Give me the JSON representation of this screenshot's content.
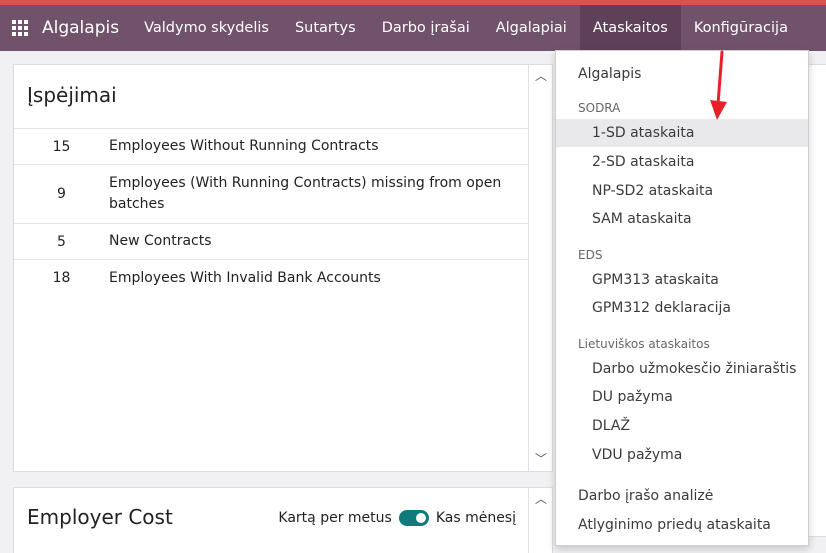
{
  "navbar": {
    "brand": "Algalapis",
    "items": [
      "Valdymo skydelis",
      "Sutartys",
      "Darbo įrašai",
      "Algalapiai",
      "Ataskaitos",
      "Konfigūracija"
    ]
  },
  "warnings": {
    "title": "Įspėjimai",
    "rows": [
      {
        "count": "15",
        "label": "Employees Without Running Contracts"
      },
      {
        "count": "9",
        "label": "Employees (With Running Contracts) missing from open batches"
      },
      {
        "count": "5",
        "label": "New Contracts"
      },
      {
        "count": "18",
        "label": "Employees With Invalid Bank Accounts"
      }
    ]
  },
  "employer_cost": {
    "title": "Employer Cost",
    "toggle_left": "Kartą per metus",
    "toggle_right": "Kas mėnesį"
  },
  "dropdown": {
    "algalapis": "Algalapis",
    "sodra_header": "SODRA",
    "sodra": [
      "1-SD ataskaita",
      "2-SD ataskaita",
      "NP-SD2 ataskaita",
      "SAM ataskaita"
    ],
    "eds_header": "EDS",
    "eds": [
      "GPM313 ataskaita",
      "GPM312 deklaracija"
    ],
    "lt_header": "Lietuviškos ataskaitos",
    "lt": [
      "Darbo užmokesčio žiniaraštis",
      "DU pažyma",
      "DLAŽ",
      "VDU pažyma"
    ],
    "analysis": "Darbo įrašo analizė",
    "bonus_report": "Atlyginimo priedų ataskaita"
  },
  "colors": {
    "navbar": "#71526b",
    "top_strip": "#d9534f",
    "toggle": "#0f7b7a",
    "annotation_arrow": "#e8202a"
  }
}
